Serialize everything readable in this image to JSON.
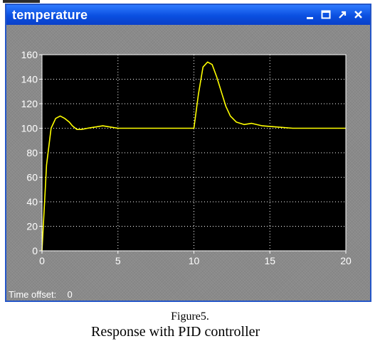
{
  "window": {
    "title": "temperature",
    "title_color": "#2456c8",
    "controls": {
      "minimize_icon": "minimize-icon",
      "maximize_icon": "maximize-icon",
      "restore_icon": "restore-icon",
      "close_icon": "close-icon"
    }
  },
  "scope": {
    "time_offset_label": "Time offset:",
    "time_offset_value": "0"
  },
  "chart_data": {
    "type": "line",
    "xlim": [
      0,
      20
    ],
    "ylim": [
      0,
      160
    ],
    "xticks": [
      0,
      5,
      10,
      15,
      20
    ],
    "yticks": [
      0,
      20,
      40,
      60,
      80,
      100,
      120,
      140,
      160
    ],
    "grid": true,
    "background": "#000000",
    "line_color": "#ffff00",
    "series": [
      {
        "x": [
          0,
          0.3,
          0.6,
          0.9,
          1.2,
          1.5,
          1.8,
          2.0,
          2.3,
          2.6,
          3.0,
          3.5,
          4.0,
          4.5,
          5.0,
          6.0,
          8.0,
          9.9,
          10.0,
          10.3,
          10.6,
          10.9,
          11.2,
          11.5,
          11.8,
          12.1,
          12.4,
          12.8,
          13.3,
          13.8,
          14.5,
          15.5,
          16.5,
          18.0,
          20.0
        ],
        "y": [
          0,
          70,
          100,
          108,
          110,
          108,
          105,
          102,
          99,
          99,
          100,
          101,
          102,
          101,
          100,
          100,
          100,
          100,
          100,
          128,
          150,
          154,
          152,
          142,
          130,
          118,
          110,
          105,
          103,
          104,
          102,
          101,
          100,
          100,
          100
        ]
      }
    ]
  },
  "figure": {
    "caption_line1": "Figure5.",
    "caption_line2": "Response with PID controller"
  }
}
